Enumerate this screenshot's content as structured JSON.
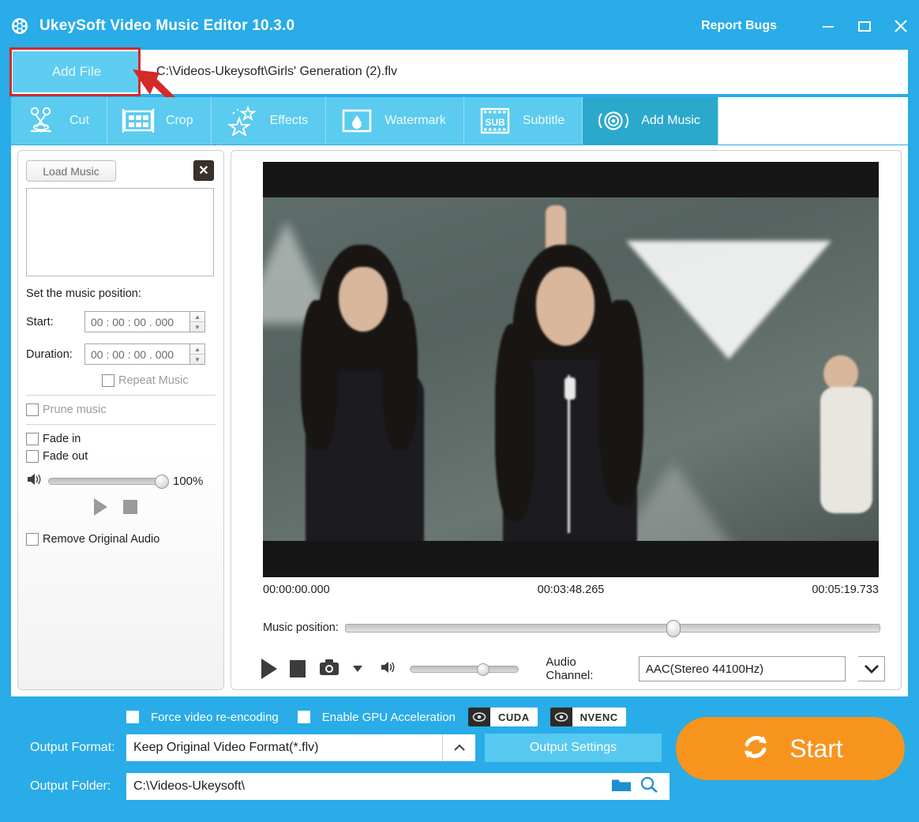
{
  "titlebar": {
    "app_icon": "film-reel-icon",
    "title": "UkeySoft Video Music Editor 10.3.0",
    "report_bugs": "Report Bugs",
    "minimize": "minimize-icon",
    "maximize": "maximize-icon",
    "close": "close-icon"
  },
  "filerow": {
    "add_file_label": "Add File",
    "file_path": "C:\\Videos-Ukeysoft\\Girls' Generation (2).flv"
  },
  "tabs": [
    {
      "label": "Cut",
      "icon": "scissors-icon",
      "active": false
    },
    {
      "label": "Crop",
      "icon": "crop-frame-icon",
      "active": false
    },
    {
      "label": "Effects",
      "icon": "stars-icon",
      "active": false
    },
    {
      "label": "Watermark",
      "icon": "droplet-icon",
      "active": false
    },
    {
      "label": "Subtitle",
      "icon": "sub-filmstrip-icon",
      "active": false
    },
    {
      "label": "Add Music",
      "icon": "speaker-ring-icon",
      "active": true
    }
  ],
  "music_panel": {
    "load_music_label": "Load Music",
    "close_label": "✕",
    "set_position_label": "Set the music position:",
    "start_label": "Start:",
    "start_value": "00 : 00 : 00 . 000",
    "duration_label": "Duration:",
    "duration_value": "00 : 00 : 00 . 000",
    "repeat_music_label": "Repeat Music",
    "prune_music_label": "Prune music",
    "fade_in_label": "Fade in",
    "fade_out_label": "Fade out",
    "volume_percent": "100%",
    "volume_value": 100,
    "play_icon": "play-icon",
    "stop_icon": "stop-icon",
    "remove_original_audio_label": "Remove Original Audio"
  },
  "preview": {
    "time_start": "00:00:00.000",
    "time_middle": "00:03:48.265",
    "time_end": "00:05:19.733",
    "music_position_label": "Music position:",
    "music_position_value": 60,
    "play_icon": "play-icon",
    "stop_icon": "stop-icon",
    "snapshot_icon": "camera-icon",
    "snapshot_caret_icon": "caret-down-icon",
    "volume_icon": "speaker-icon",
    "volume_value": 62,
    "audio_channel_label": "Audio Channel:",
    "audio_channel_value": "AAC(Stereo 44100Hz)",
    "audio_channel_caret": "chevron-down-icon"
  },
  "bottom": {
    "force_reencoding_label": "Force video re-encoding",
    "enable_gpu_label": "Enable GPU Acceleration",
    "cuda_label": "CUDA",
    "nvenc_label": "NVENC",
    "output_format_label": "Output Format:",
    "output_format_value": "Keep Original Video Format(*.flv)",
    "output_format_caret": "caret-up-icon",
    "output_settings_label": "Output Settings",
    "output_folder_label": "Output Folder:",
    "output_folder_value": "C:\\Videos-Ukeysoft\\",
    "folder_icon": "folder-icon",
    "search_icon": "magnifier-icon",
    "start_label": "Start",
    "start_icon": "refresh-cycle-icon"
  },
  "colors": {
    "header_blue": "#29ace8",
    "tabbar_blue": "#5bcbef",
    "tab_active_blue": "#2ba8cc",
    "accent_orange": "#f7941e",
    "annotation_red": "#d32a2a"
  }
}
